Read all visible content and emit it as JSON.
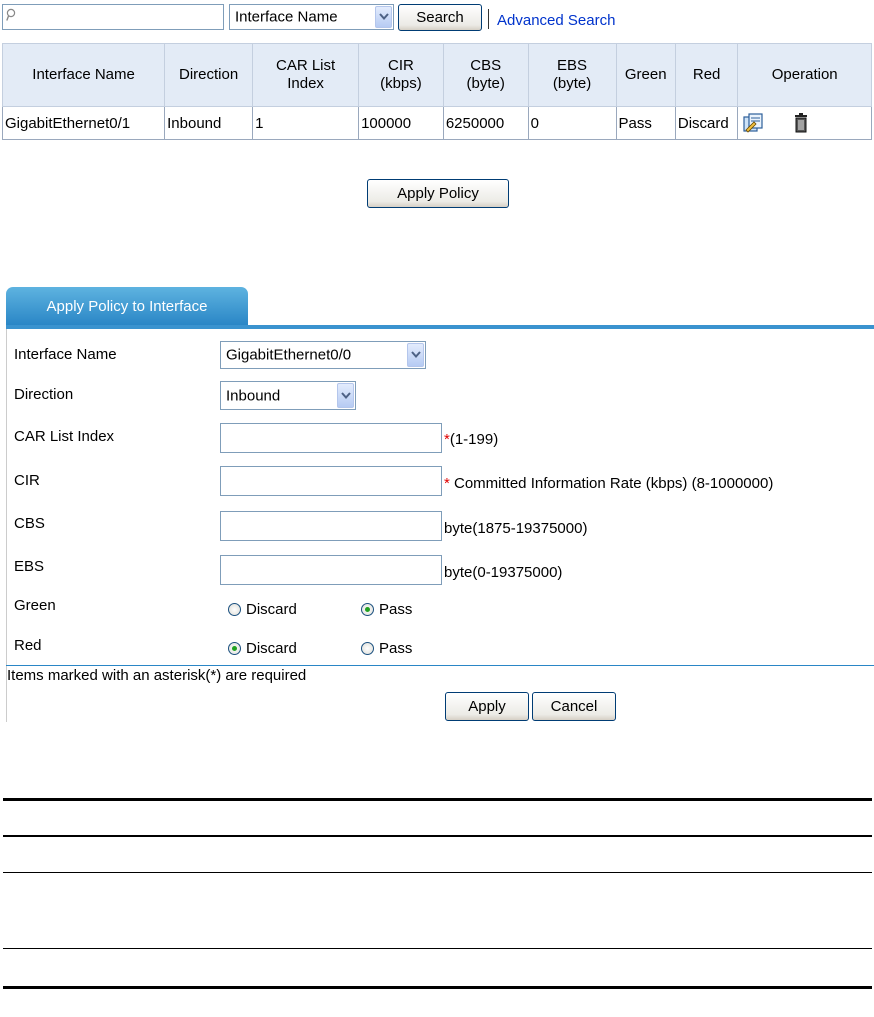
{
  "search": {
    "placeholder": "",
    "field_value": "Interface Name",
    "button": "Search",
    "advanced_link": "Advanced Search"
  },
  "table": {
    "headers": [
      "Interface Name",
      "Direction",
      "CAR List Index",
      "CIR (kbps)",
      "CBS (byte)",
      "EBS (byte)",
      "Green",
      "Red",
      "Operation"
    ],
    "rows": [
      {
        "interface": "GigabitEthernet0/1",
        "direction": "Inbound",
        "car_index": "1",
        "cir": "100000",
        "cbs": "6250000",
        "ebs": "0",
        "green": "Pass",
        "red": "Discard",
        "operations": [
          "modify-icon",
          "delete-icon"
        ]
      }
    ]
  },
  "apply_policy_button": "Apply Policy",
  "form": {
    "tab_title": "Apply Policy to Interface",
    "interface_label": "Interface Name",
    "interface_value": "GigabitEthernet0/0",
    "direction_label": "Direction",
    "direction_value": "Inbound",
    "car_label": "CAR List Index",
    "car_value": "",
    "car_hint": "(1-199)",
    "cir_label": "CIR",
    "cir_value": "",
    "cir_hint": " Committed Information Rate (kbps) (8-1000000)",
    "cbs_label": "CBS",
    "cbs_value": "",
    "cbs_hint": "byte(1875-19375000)",
    "ebs_label": "EBS",
    "ebs_value": "",
    "ebs_hint": "byte(0-19375000)",
    "green_label": "Green",
    "green_options": [
      "Discard",
      "Pass"
    ],
    "green_selected": "Pass",
    "red_label": "Red",
    "red_options": [
      "Discard",
      "Pass"
    ],
    "red_selected": "Discard",
    "asterisk": "*",
    "required_note": "Items marked with an asterisk(*) are required",
    "apply_button": "Apply",
    "cancel_button": "Cancel"
  },
  "colors": {
    "tab": "#2a86c6",
    "header_bg": "#e3ebf6",
    "link": "#0033cc",
    "required": "#e00000"
  }
}
